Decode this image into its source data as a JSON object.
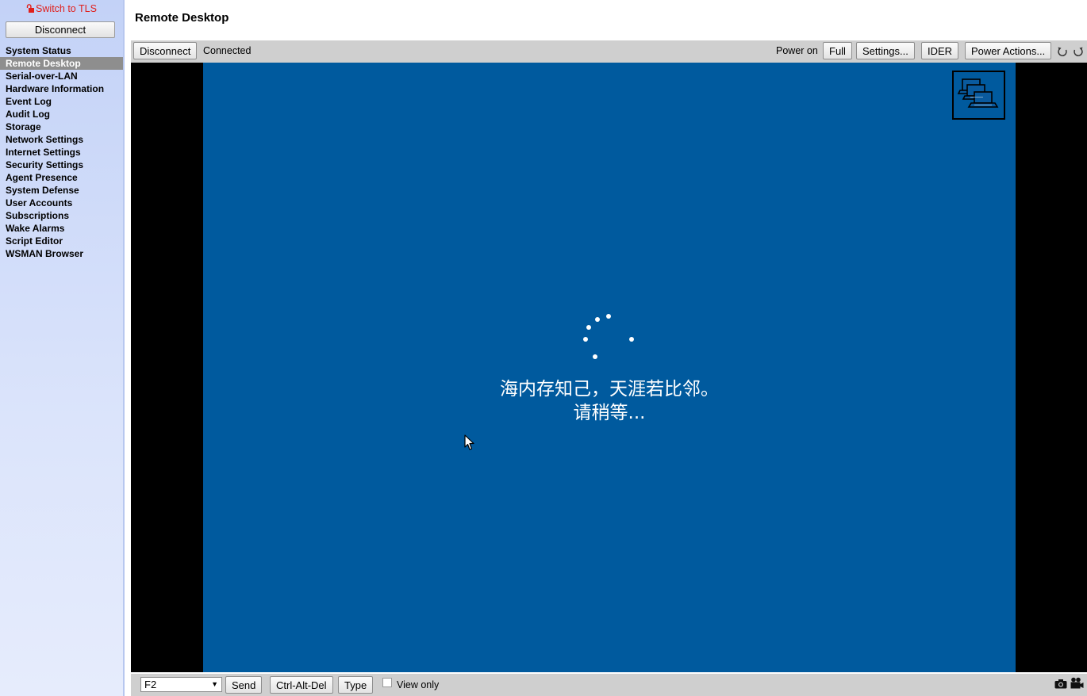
{
  "sidebar": {
    "tls_link": "Switch to TLS",
    "disconnect_label": "Disconnect",
    "items": [
      {
        "label": "System Status",
        "active": false
      },
      {
        "label": "Remote Desktop",
        "active": true
      },
      {
        "label": "Serial-over-LAN",
        "active": false
      },
      {
        "label": "Hardware Information",
        "active": false
      },
      {
        "label": "Event Log",
        "active": false
      },
      {
        "label": "Audit Log",
        "active": false
      },
      {
        "label": "Storage",
        "active": false
      },
      {
        "label": "Network Settings",
        "active": false
      },
      {
        "label": "Internet Settings",
        "active": false
      },
      {
        "label": "Security Settings",
        "active": false
      },
      {
        "label": "Agent Presence",
        "active": false
      },
      {
        "label": "System Defense",
        "active": false
      },
      {
        "label": "User Accounts",
        "active": false
      },
      {
        "label": "Subscriptions",
        "active": false
      },
      {
        "label": "Wake Alarms",
        "active": false
      },
      {
        "label": "Script Editor",
        "active": false
      },
      {
        "label": "WSMAN Browser",
        "active": false
      }
    ]
  },
  "header": {
    "title": "Remote Desktop"
  },
  "top_toolbar": {
    "disconnect_label": "Disconnect",
    "status": "Connected",
    "power_status": "Power on",
    "full_label": "Full",
    "settings_label": "Settings...",
    "ider_label": "IDER",
    "power_actions_label": "Power Actions...",
    "icons": [
      "rotate-left-icon",
      "rotate-right-icon"
    ]
  },
  "remote_screen": {
    "message_line1": "海内存知己，天涯若比邻。",
    "message_line2": "请稍等...",
    "colors": {
      "desktop_bg": "#005a9e",
      "frame_bg": "#000000"
    }
  },
  "bottom_toolbar": {
    "key_selected": "F2",
    "send_label": "Send",
    "ctrl_alt_del_label": "Ctrl-Alt-Del",
    "type_label": "Type",
    "view_only_label": "View only",
    "view_only_checked": false,
    "icons": [
      "camera-icon",
      "video-camera-icon"
    ]
  },
  "colors": {
    "tls_link": "#e0201c",
    "nav_active_bg": "#8e8e8e",
    "toolbar_bg": "#cfcfcf"
  }
}
